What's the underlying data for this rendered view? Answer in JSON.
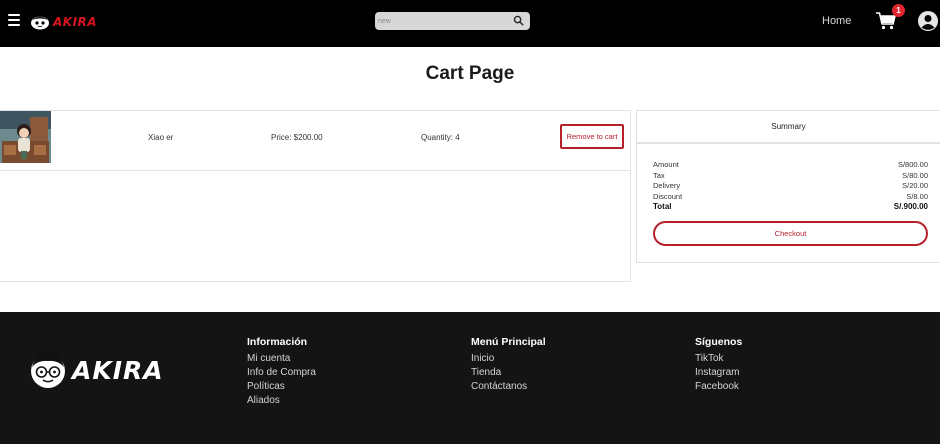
{
  "header": {
    "brand": "AKIRA",
    "search_placeholder": "new",
    "nav_home": "Home",
    "cart_count": "1",
    "colors": {
      "bar": "#000000",
      "badge": "#e0262e",
      "brand_red": "#d6141e"
    }
  },
  "page": {
    "title": "Cart Page"
  },
  "cart": {
    "items": [
      {
        "name": "Xiao er",
        "price": "Price: $200.00",
        "quantity": "Quantity: 4",
        "action": "Remove to cart",
        "thumb_icon": "figure-product-image"
      }
    ]
  },
  "summary": {
    "title": "Summary",
    "rows": [
      {
        "label": "Amount",
        "value": "S/800.00"
      },
      {
        "label": "Tax",
        "value": "S/80.00"
      },
      {
        "label": "Delivery",
        "value": "S/20.00"
      },
      {
        "label": "Discount",
        "value": "S/8.00"
      }
    ],
    "total": {
      "label": "Total",
      "value": "S/.900.00"
    },
    "checkout": "Checkout"
  },
  "footer": {
    "brand": "AKIRA",
    "columns": [
      {
        "title": "Información",
        "links": [
          "Mi cuenta",
          "Info de Compra",
          "Políticas",
          "Aliados"
        ]
      },
      {
        "title": "Menú Principal",
        "links": [
          "Inicio",
          "Tienda",
          "Contáctanos"
        ]
      },
      {
        "title": "Síguenos",
        "links": [
          "TikTok",
          "Instagram",
          "Facebook"
        ]
      }
    ]
  }
}
